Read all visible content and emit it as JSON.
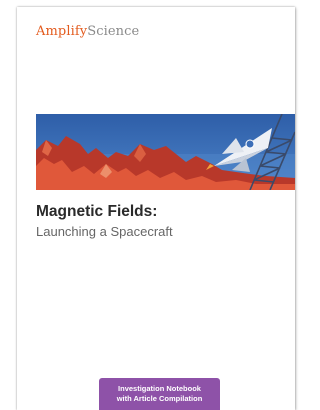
{
  "logo": {
    "brand": "Amplify",
    "product": "Science"
  },
  "cover": {
    "title": "Magnetic Fields:",
    "subtitle": "Launching a Spacecraft"
  },
  "badge": {
    "line1": "Investigation Notebook",
    "line2": "with Article Compilation"
  },
  "colors": {
    "brand": "#e35b1e",
    "badge": "#8e52a8",
    "sky": "#3d6fb8",
    "mountains": "#d44a2e"
  },
  "banner_icon": "rocket-launch-illustration"
}
